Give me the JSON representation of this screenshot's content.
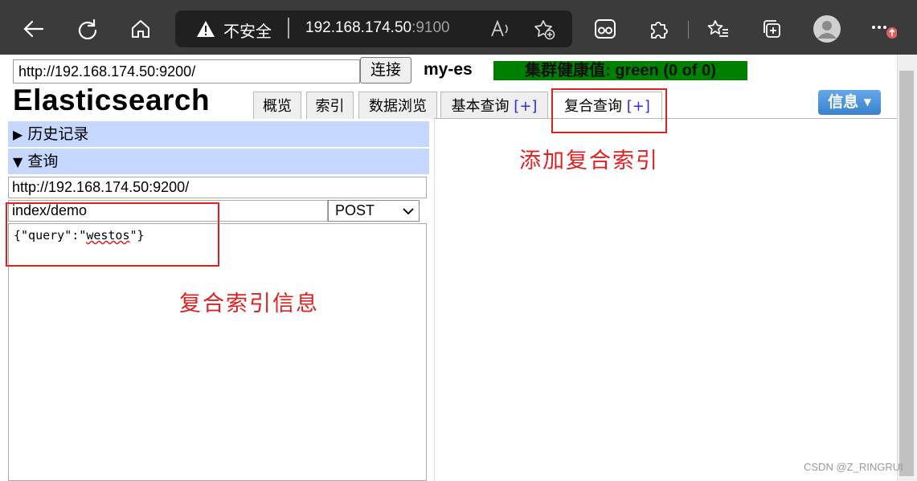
{
  "browser": {
    "insecure_label": "不安全",
    "address_host": "192.168.174.50",
    "address_port": ":9100"
  },
  "header": {
    "cluster_url": "http://192.168.174.50:9200/",
    "connect_label": "连接",
    "cluster_name": "my-es",
    "health_label": "集群健康值: green (0 of 0)",
    "health_color": "#008000",
    "logo": "Elasticsearch",
    "info_label": "信息"
  },
  "tabs": [
    {
      "label": "概览"
    },
    {
      "label": "索引"
    },
    {
      "label": "数据浏览"
    },
    {
      "label": "基本查询",
      "plus": "[+]"
    },
    {
      "label": "复合查询",
      "plus": "[+]"
    }
  ],
  "left_panel": {
    "history_label": "历史记录",
    "query_label": "查询",
    "query_url": "http://192.168.174.50:9200/",
    "query_path": "index/demo",
    "method": "POST",
    "body_prefix": "{\"query\":\"",
    "body_value": "westos",
    "body_suffix": "\"}"
  },
  "annotations": {
    "add_compound_index": "添加复合索引",
    "compound_index_info": "复合索引信息",
    "annotation_color": "#e02020"
  },
  "watermark": "CSDN @Z_RINGRUI"
}
